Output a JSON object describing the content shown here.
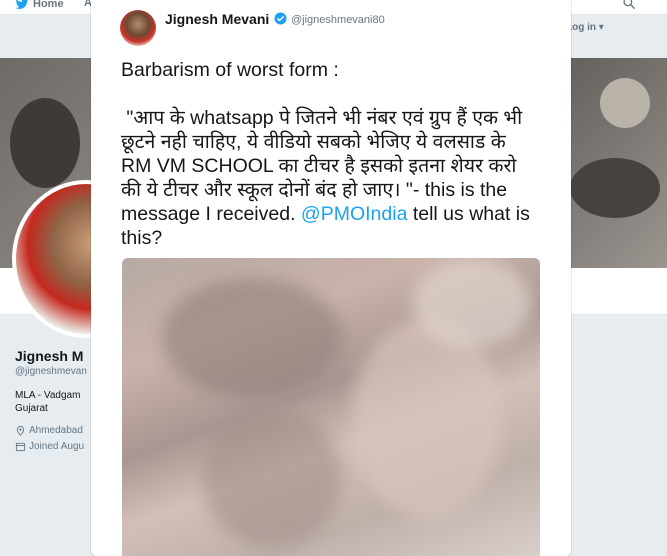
{
  "topbar": {
    "home_label": "Home",
    "more_label": "A",
    "login_label": "Log in ▾"
  },
  "profile": {
    "name": "Jignesh M",
    "handle": "@jigneshmevan",
    "bio_line1": "MLA - Vadgam",
    "bio_line2": "Gujarat",
    "location": "Ahmedabad",
    "joined": "Joined Augu"
  },
  "tweet": {
    "author_name": "Jignesh Mevani",
    "author_handle": "@jigneshmevani80",
    "text_before_mention": "Barbarism of worst form :\n\n \"आप के whatsapp पे जितने भी नंबर एवं ग्रुप हैं एक भी छूटने नही चाहिए, ये वीडियो सबको भेजिए ये वलसाड के RM VM SCHOOL का टीचर है इसको इतना शेयर करो की ये टीचर और स्कूल दोनों बंद हो जाए। \"- this is the message I received. ",
    "mention": "@PMOIndia",
    "text_after_mention": " tell us what is this?"
  },
  "colors": {
    "link": "#1da1f2",
    "verified": "#1da1f2",
    "text": "#14171a",
    "muted": "#657786"
  },
  "icons": [
    "twitter-bird-icon",
    "search-icon",
    "verified-badge-icon",
    "location-pin-icon",
    "calendar-icon"
  ]
}
